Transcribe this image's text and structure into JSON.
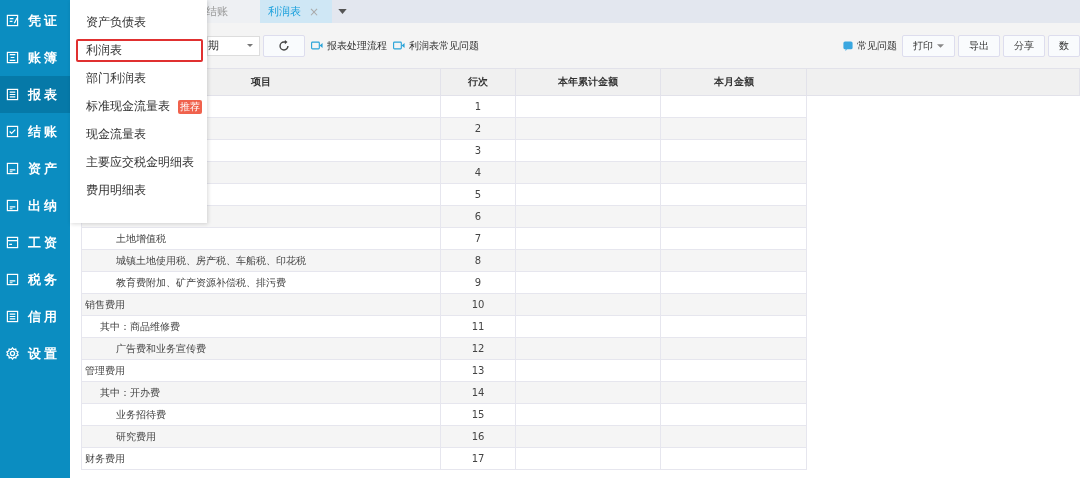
{
  "sidebar": {
    "items": [
      {
        "label": "凭证",
        "selected": false
      },
      {
        "label": "账簿",
        "selected": false
      },
      {
        "label": "报表",
        "selected": true
      },
      {
        "label": "结账",
        "selected": false
      },
      {
        "label": "资产",
        "selected": false
      },
      {
        "label": "出纳",
        "selected": false
      },
      {
        "label": "工资",
        "selected": false
      },
      {
        "label": "税务",
        "selected": false
      },
      {
        "label": "信用",
        "selected": false
      },
      {
        "label": "设置",
        "selected": false
      }
    ]
  },
  "tabs": [
    {
      "label": "结账",
      "selected": false
    },
    {
      "label": "利润表",
      "selected": true,
      "close": "×"
    }
  ],
  "report_menu": {
    "items": [
      {
        "label": "资产负债表",
        "selected": false
      },
      {
        "label": "利润表",
        "selected": true
      },
      {
        "label": "部门利润表",
        "selected": false
      },
      {
        "label": "标准现金流量表",
        "selected": false,
        "badge": "推荐"
      },
      {
        "label": "现金流量表",
        "selected": false
      },
      {
        "label": "主要应交税金明细表",
        "selected": false
      },
      {
        "label": "费用明细表",
        "selected": false
      }
    ]
  },
  "toolbar": {
    "period_select": "期",
    "links": [
      "报表处理流程",
      "利润表常见问题"
    ],
    "help": "常见问题",
    "print": "打印",
    "buttons": [
      "导出",
      "分享",
      "数"
    ]
  },
  "table": {
    "columns": [
      "项目",
      "行次",
      "本年累计金额",
      "本月金额"
    ],
    "rows": [
      {
        "line": "1"
      },
      {
        "line": "2"
      },
      {
        "line": "3"
      },
      {
        "line": "4"
      },
      {
        "line": "5"
      },
      {
        "line": "6"
      },
      {
        "item": "土地增值税",
        "kind": "detail",
        "line": "7"
      },
      {
        "item": "城镇土地使用税、房产税、车船税、印花税",
        "kind": "detail",
        "line": "8"
      },
      {
        "item": "教育费附加、矿产资源补偿税、排污费",
        "kind": "detail",
        "line": "9"
      },
      {
        "item": "销售费用",
        "kind": "main",
        "line": "10"
      },
      {
        "item": "其中：商品维修费",
        "kind": "sub",
        "line": "11"
      },
      {
        "item": "广告费和业务宣传费",
        "kind": "detail",
        "line": "12"
      },
      {
        "item": "管理费用",
        "kind": "main",
        "line": "13"
      },
      {
        "item": "其中：开办费",
        "kind": "sub",
        "line": "14"
      },
      {
        "item": "业务招待费",
        "kind": "detail",
        "line": "15"
      },
      {
        "item": "研究费用",
        "kind": "detail",
        "line": "16"
      },
      {
        "item": "财务费用",
        "kind": "main",
        "line": "17"
      }
    ]
  }
}
